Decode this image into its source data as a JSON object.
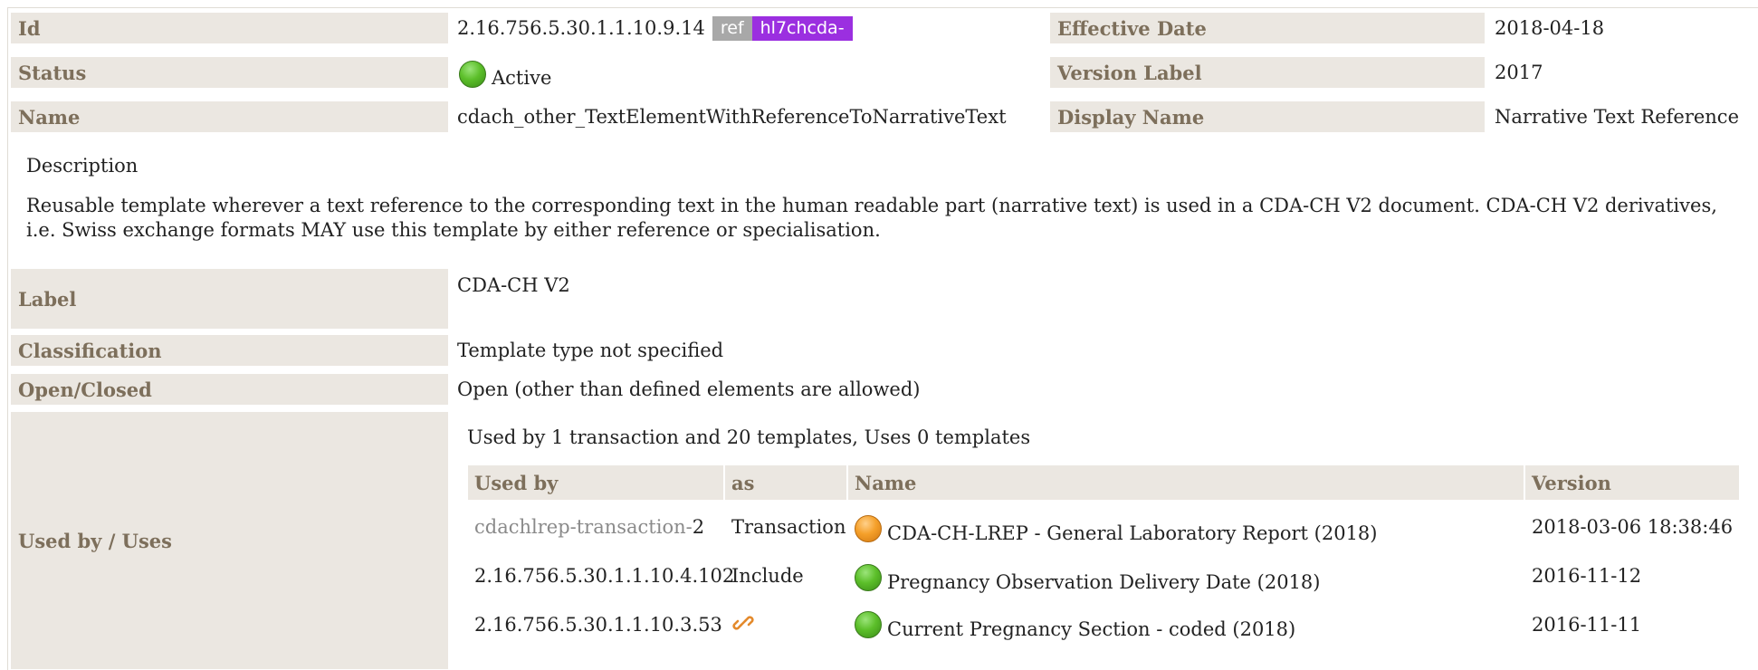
{
  "header": {
    "id_label": "Id",
    "id_value": "2.16.756.5.30.1.1.10.9.14",
    "ref_badge": "ref",
    "prefix_badge": "hl7chcda-",
    "effective_date_label": "Effective Date",
    "effective_date_value": "2018-04-18",
    "status_label": "Status",
    "status_value": "Active",
    "version_label_label": "Version Label",
    "version_label_value": "2017",
    "name_label": "Name",
    "name_value": "cdach_other_TextElementWithReferenceToNarrativeText",
    "display_name_label": "Display Name",
    "display_name_value": "Narrative Text Reference"
  },
  "description": {
    "heading": "Description",
    "text": "Reusable template wherever a text reference to the corresponding text in the human readable part (narrative text) is used in a CDA-CH V2 document. CDA-CH V2 derivatives, i.e. Swiss exchange formats MAY use this template by either reference or specialisation."
  },
  "properties": {
    "label_label": "Label",
    "label_value": "CDA-CH V2",
    "classification_label": "Classification",
    "classification_value": "Template type not specified",
    "open_closed_label": "Open/Closed",
    "open_closed_value": "Open (other than defined elements are allowed)",
    "used_by_label": "Used by / Uses"
  },
  "usage": {
    "summary": "Used by 1 transaction and 20 templates, Uses 0 templates",
    "columns": [
      "Used by",
      "as",
      "Name",
      "Version"
    ],
    "rows": [
      {
        "used_by_prefix": "cdachlrep-transaction-",
        "used_by_suffix": "2",
        "as": "Transaction",
        "status_color": "orange",
        "name": "CDA-CH-LREP - General Laboratory Report (2018)",
        "version": "2018-03-06 18:38:46"
      },
      {
        "used_by": "2.16.756.5.30.1.1.10.4.102",
        "as": "Include",
        "status_color": "green",
        "name": "Pregnancy Observation Delivery Date (2018)",
        "version": "2016-11-12"
      },
      {
        "used_by": "2.16.756.5.30.1.1.10.3.53",
        "as_icon": "link-icon",
        "status_color": "green",
        "name": "Current Pregnancy Section - coded (2018)",
        "version": "2016-11-11"
      }
    ]
  },
  "colors": {
    "label_bg": "#ebe7e1",
    "label_text": "#7d6f5b",
    "ref_badge": "#a8a8a8",
    "prefix_badge": "#9b2fe0",
    "status_active": "#5cbf2a",
    "status_draft": "#f5a02a"
  }
}
